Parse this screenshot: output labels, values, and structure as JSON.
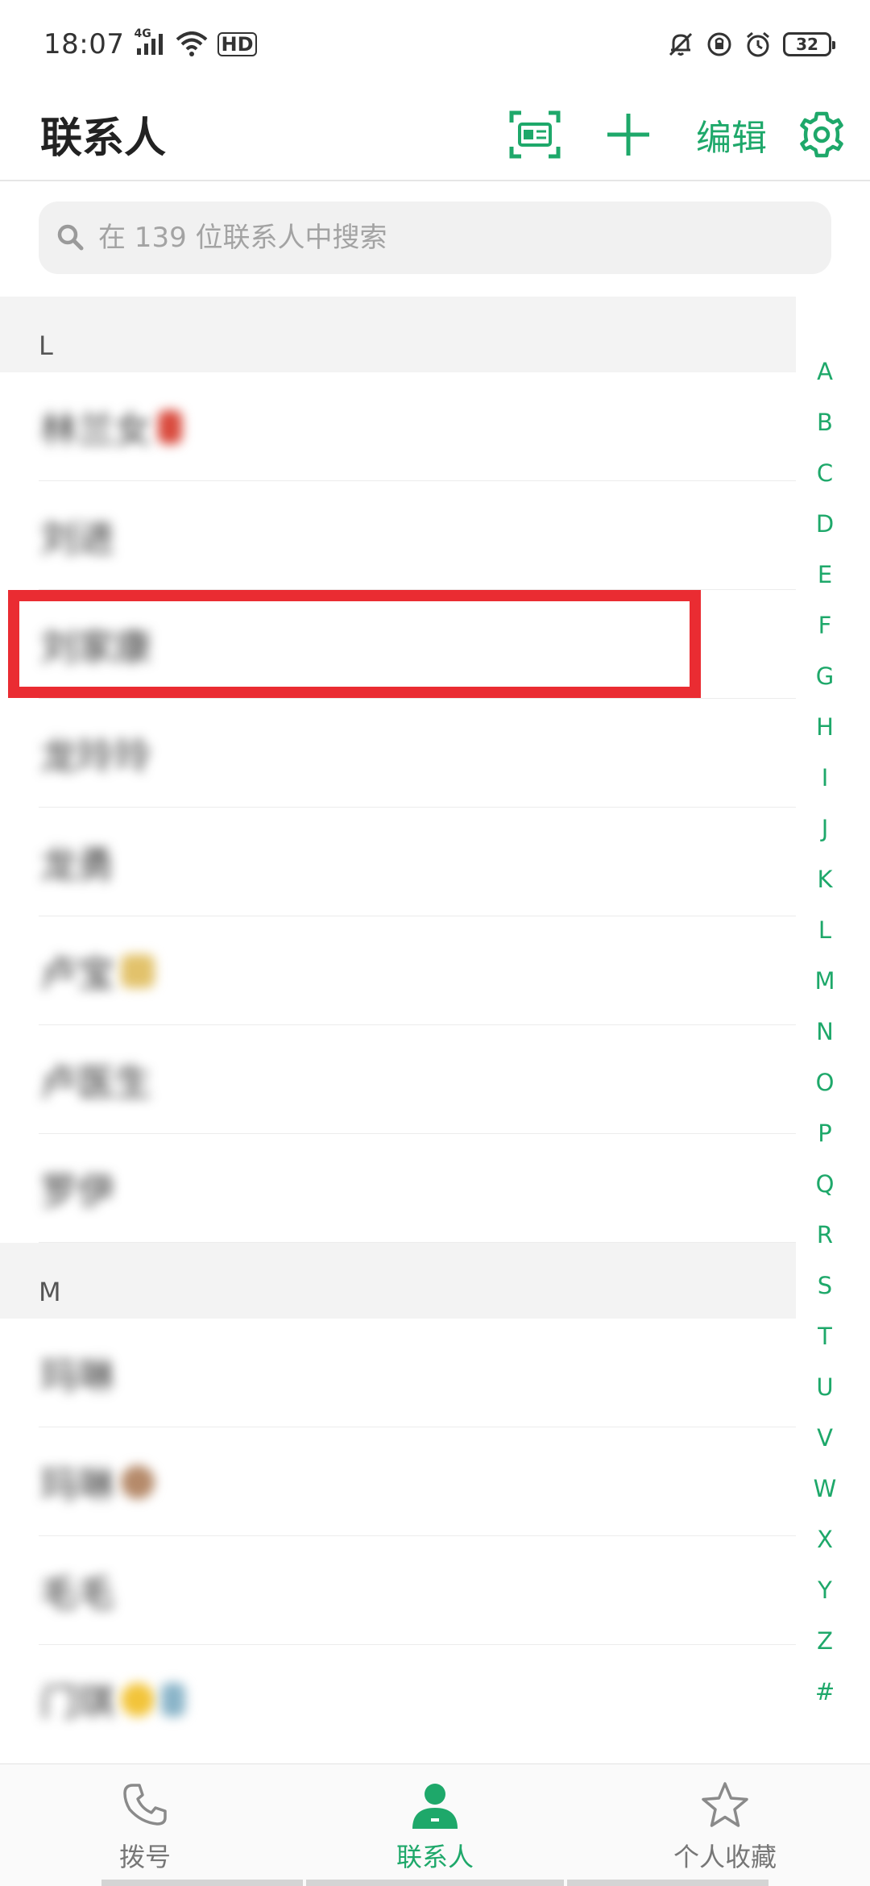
{
  "status_bar": {
    "time": "18:07",
    "network": "4G",
    "hd": "HD",
    "battery": "32"
  },
  "header": {
    "title": "联系人",
    "edit_label": "编辑"
  },
  "search": {
    "placeholder": "在 139 位联系人中搜索"
  },
  "sections": [
    {
      "letter": "L",
      "contacts": [
        "林兰女",
        "刘进",
        "刘家康",
        "龙玲玲",
        "龙勇",
        "卢宝",
        "卢医生",
        "罗伊"
      ]
    },
    {
      "letter": "M",
      "contacts": [
        "玛琳",
        "玛琳",
        "毛毛",
        "门琪"
      ]
    }
  ],
  "alphabet_index": [
    "A",
    "B",
    "C",
    "D",
    "E",
    "F",
    "G",
    "H",
    "I",
    "J",
    "K",
    "L",
    "M",
    "N",
    "O",
    "P",
    "Q",
    "R",
    "S",
    "T",
    "U",
    "V",
    "W",
    "X",
    "Y",
    "Z",
    "#"
  ],
  "bottom_nav": {
    "dial_label": "拨号",
    "contacts_label": "联系人",
    "favorites_label": "个人收藏"
  },
  "colors": {
    "accent": "#1ea86a",
    "highlight": "#ea2c32"
  }
}
